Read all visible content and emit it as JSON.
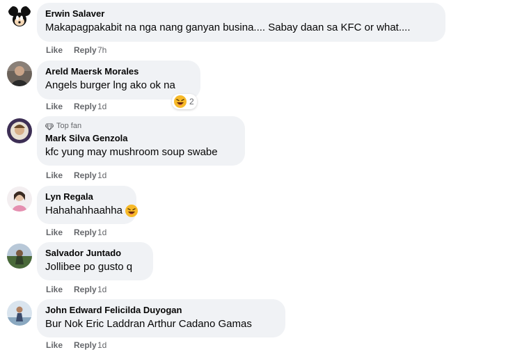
{
  "comments": [
    {
      "name": "Erwin Salaver",
      "text": "Makapagpakabit na nga nang ganyan busina.... Sabay daan sa KFC or what....",
      "like": "Like",
      "reply": "Reply",
      "time": "7h"
    },
    {
      "name": "Areld Maersk Morales",
      "text": "Angels burger lng ako ok na",
      "like": "Like",
      "reply": "Reply",
      "time": "1d",
      "reaction_count": "2",
      "reaction_icon": "laughing-emoji-icon"
    },
    {
      "badge": "Top fan",
      "badge_icon": "diamond-icon",
      "name": "Mark Silva Genzola",
      "text": "kfc yung may mushroom soup swabe",
      "like": "Like",
      "reply": "Reply",
      "time": "1d"
    },
    {
      "name": "Lyn Regala",
      "text": "Hahahahhaahha",
      "like": "Like",
      "reply": "Reply",
      "time": "1d",
      "inline_icon": "laughing-emoji-icon"
    },
    {
      "name": "Salvador Juntado",
      "text": "Jollibee po gusto q",
      "like": "Like",
      "reply": "Reply",
      "time": "1d"
    },
    {
      "name": "John Edward Felicilda Duyogan",
      "text": "Bur Nok Eric Laddran Arthur Cadano Gamas",
      "like": "Like",
      "reply": "Reply",
      "time": "1d"
    }
  ],
  "colors": {
    "bubble": "#f0f2f5",
    "secondary_text": "#65676b",
    "primary_text": "#050505"
  }
}
